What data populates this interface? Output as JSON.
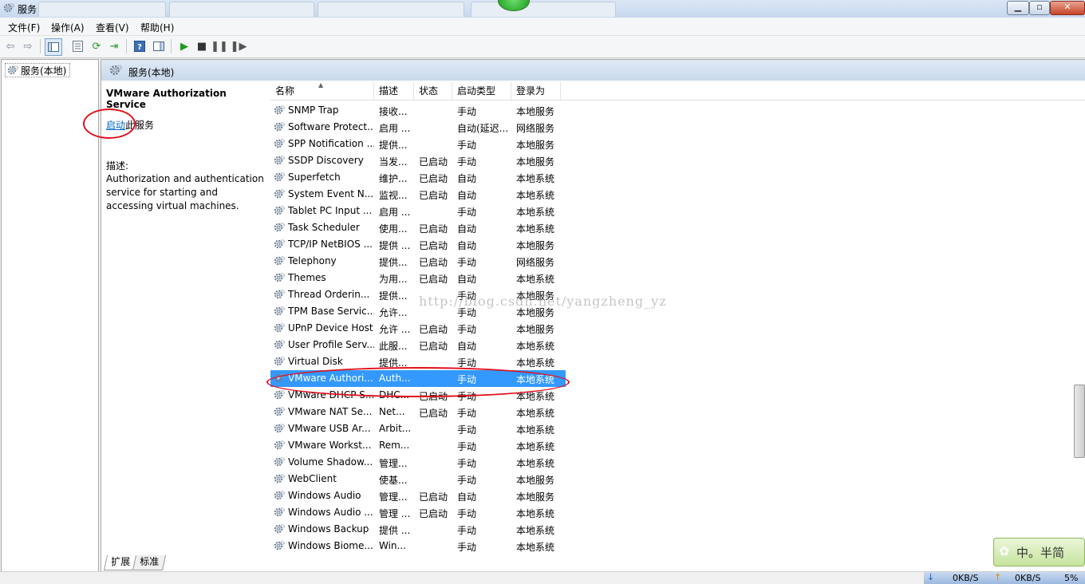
{
  "window": {
    "title": "服务"
  },
  "menu": [
    "文件(F)",
    "操作(A)",
    "查看(V)",
    "帮助(H)"
  ],
  "tree": {
    "root_label": "服务(本地)"
  },
  "right_header": {
    "title": "服务(本地)"
  },
  "detail": {
    "service_name": "VMware Authorization Service",
    "start_link": "启动",
    "start_suffix": "此服务",
    "desc_label": "描述:",
    "desc_text": "Authorization and authentication service for starting and accessing virtual machines."
  },
  "columns": [
    "名称",
    "描述",
    "状态",
    "启动类型",
    "登录为"
  ],
  "rows": [
    {
      "name": "SNMP Trap",
      "desc": "接收...",
      "status": "",
      "startup": "手动",
      "logon": "本地服务"
    },
    {
      "name": "Software Protect...",
      "desc": "启用 ...",
      "status": "",
      "startup": "自动(延迟...",
      "logon": "网络服务"
    },
    {
      "name": "SPP Notification ...",
      "desc": "提供...",
      "status": "",
      "startup": "手动",
      "logon": "本地服务"
    },
    {
      "name": "SSDP Discovery",
      "desc": "当发...",
      "status": "已启动",
      "startup": "手动",
      "logon": "本地服务"
    },
    {
      "name": "Superfetch",
      "desc": "维护...",
      "status": "已启动",
      "startup": "自动",
      "logon": "本地系统"
    },
    {
      "name": "System Event N...",
      "desc": "监视...",
      "status": "已启动",
      "startup": "自动",
      "logon": "本地系统"
    },
    {
      "name": "Tablet PC Input ...",
      "desc": "启用 ...",
      "status": "",
      "startup": "手动",
      "logon": "本地系统"
    },
    {
      "name": "Task Scheduler",
      "desc": "使用...",
      "status": "已启动",
      "startup": "自动",
      "logon": "本地系统"
    },
    {
      "name": "TCP/IP NetBIOS ...",
      "desc": "提供 ...",
      "status": "已启动",
      "startup": "自动",
      "logon": "本地服务"
    },
    {
      "name": "Telephony",
      "desc": "提供...",
      "status": "已启动",
      "startup": "手动",
      "logon": "网络服务"
    },
    {
      "name": "Themes",
      "desc": "为用...",
      "status": "已启动",
      "startup": "自动",
      "logon": "本地系统"
    },
    {
      "name": "Thread Orderin...",
      "desc": "提供...",
      "status": "",
      "startup": "手动",
      "logon": "本地服务"
    },
    {
      "name": "TPM Base Servic...",
      "desc": "允许...",
      "status": "",
      "startup": "手动",
      "logon": "本地服务"
    },
    {
      "name": "UPnP Device Host",
      "desc": "允许 ...",
      "status": "已启动",
      "startup": "手动",
      "logon": "本地服务"
    },
    {
      "name": "User Profile Serv...",
      "desc": "此服...",
      "status": "已启动",
      "startup": "自动",
      "logon": "本地系统"
    },
    {
      "name": "Virtual Disk",
      "desc": "提供...",
      "status": "",
      "startup": "手动",
      "logon": "本地系统"
    },
    {
      "name": "VMware Authori...",
      "desc": "Auth...",
      "status": "",
      "startup": "手动",
      "logon": "本地系统",
      "selected": true
    },
    {
      "name": "VMware DHCP S...",
      "desc": "DHC...",
      "status": "已启动",
      "startup": "手动",
      "logon": "本地系统"
    },
    {
      "name": "VMware NAT Se...",
      "desc": "Net...",
      "status": "已启动",
      "startup": "手动",
      "logon": "本地系统"
    },
    {
      "name": "VMware USB Ar...",
      "desc": "Arbit...",
      "status": "",
      "startup": "手动",
      "logon": "本地系统"
    },
    {
      "name": "VMware Workst...",
      "desc": "Rem...",
      "status": "",
      "startup": "手动",
      "logon": "本地系统"
    },
    {
      "name": "Volume Shadow...",
      "desc": "管理...",
      "status": "",
      "startup": "手动",
      "logon": "本地系统"
    },
    {
      "name": "WebClient",
      "desc": "使基...",
      "status": "",
      "startup": "手动",
      "logon": "本地服务"
    },
    {
      "name": "Windows Audio",
      "desc": "管理...",
      "status": "已启动",
      "startup": "自动",
      "logon": "本地服务"
    },
    {
      "name": "Windows Audio ...",
      "desc": "管理 ...",
      "status": "已启动",
      "startup": "手动",
      "logon": "本地系统"
    },
    {
      "name": "Windows Backup",
      "desc": "提供 ...",
      "status": "",
      "startup": "手动",
      "logon": "本地系统"
    },
    {
      "name": "Windows Biome...",
      "desc": "Win...",
      "status": "",
      "startup": "手动",
      "logon": "本地系统"
    }
  ],
  "tabs": [
    "扩展",
    "标准"
  ],
  "watermark": "http://blog.csdn.net/yangzheng_yz",
  "ime": {
    "label": "中。半简"
  },
  "netmon": {
    "down": "0KB/S",
    "up": "0KB/S",
    "cpu": "5%"
  },
  "icons": {
    "gear": "gear-icon",
    "back": "back-arrow-icon",
    "forward": "forward-arrow-icon",
    "play": "play-icon",
    "stop": "stop-icon",
    "pause": "pause-icon",
    "restart": "restart-icon"
  },
  "colors": {
    "selection": "#3399ff",
    "annotation": "#e0101c",
    "link": "#0066cc"
  }
}
